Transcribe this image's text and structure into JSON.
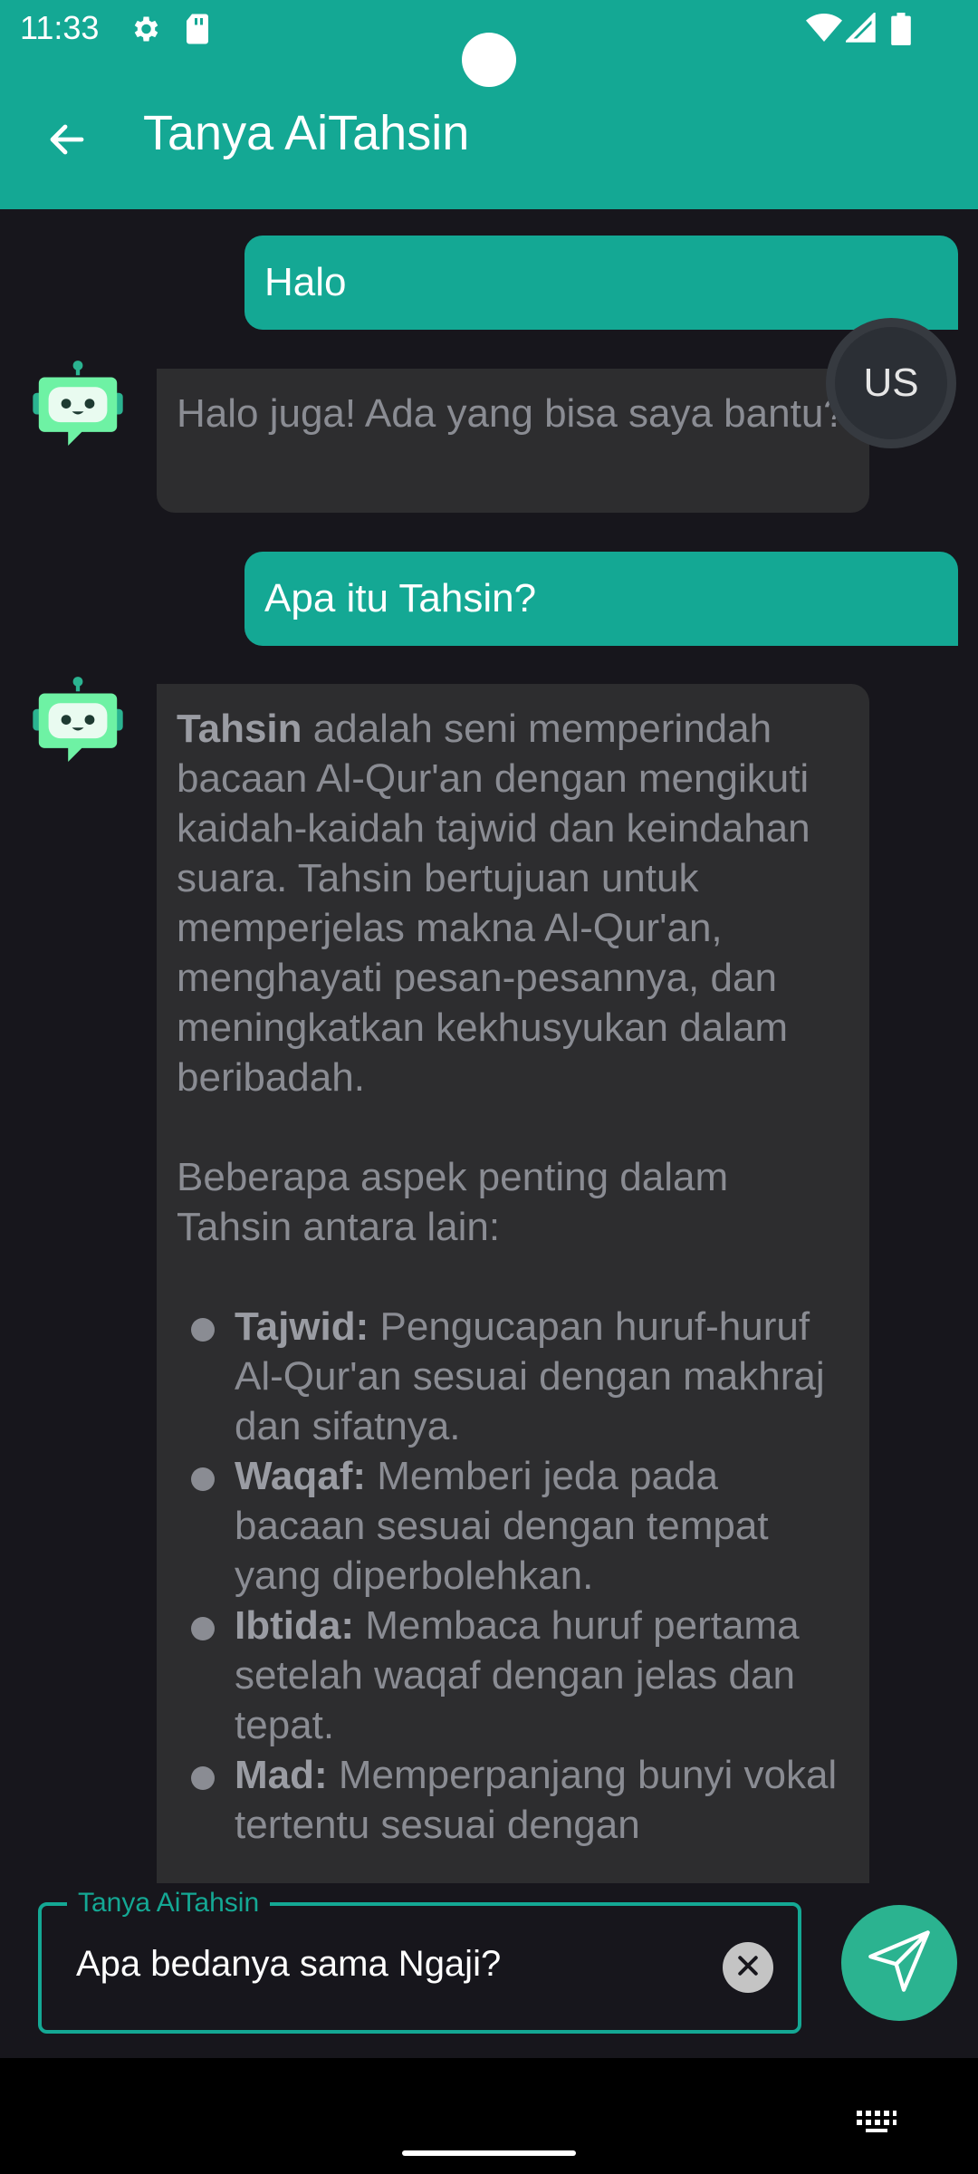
{
  "status_bar": {
    "time": "11:33",
    "icons": [
      "settings-icon",
      "sd-card-icon",
      "wifi-icon",
      "signal-icon",
      "battery-icon"
    ]
  },
  "app_bar": {
    "title": "Tanya AiTahsin",
    "back_icon": "arrow-left-icon"
  },
  "messages": [
    {
      "sender": "user",
      "text": "Halo"
    },
    {
      "sender": "bot",
      "text": "Halo juga! Ada yang bisa saya bantu?"
    },
    {
      "sender": "user",
      "text": "Apa itu Tahsin?"
    },
    {
      "sender": "bot",
      "intro_bold": "Tahsin",
      "intro_rest": " adalah seni memperindah bacaan Al-Qur'an dengan mengikuti kaidah-kaidah tajwid dan keindahan suara. Tahsin bertujuan untuk memperjelas makna Al-Qur'an, menghayati pesan-pesannya, dan meningkatkan kekhusyukan dalam beribadah.",
      "aspects_intro": "Beberapa aspek penting dalam Tahsin antara lain:",
      "bullets": [
        {
          "term": "Tajwid:",
          "desc": " Pengucapan huruf-huruf Al-Qur'an sesuai dengan makhraj dan sifatnya."
        },
        {
          "term": "Waqaf:",
          "desc": " Memberi jeda pada bacaan sesuai dengan tempat yang diperbolehkan."
        },
        {
          "term": "Ibtida:",
          "desc": " Membaca huruf pertama setelah waqaf dengan jelas dan tepat."
        },
        {
          "term": "Mad:",
          "desc": " Memperpanjang bunyi vokal tertentu sesuai dengan"
        }
      ]
    }
  ],
  "language_button": {
    "label": "US"
  },
  "input": {
    "label": "Tanya AiTahsin",
    "value": "Apa bedanya sama Ngaji?",
    "clear_icon": "clear-icon",
    "send_icon": "send-icon"
  },
  "colors": {
    "accent": "#14a894",
    "background": "#17161c",
    "bot_bubble": "#2d2d2f",
    "bot_text": "#8a8c93"
  }
}
